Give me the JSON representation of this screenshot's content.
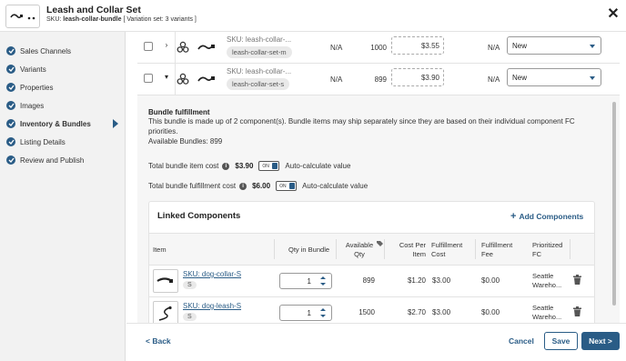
{
  "header": {
    "title": "Leash and Collar Set",
    "sku_label": "SKU:",
    "sku_value": "leash-collar-bundle",
    "variation_note": "[ Variation set: 3 variants ]",
    "close_icon": "close-icon"
  },
  "sidebar": {
    "items": [
      {
        "label": "Sales Channels",
        "icon": "check-circle-icon"
      },
      {
        "label": "Variants",
        "icon": "check-circle-icon"
      },
      {
        "label": "Properties",
        "icon": "check-circle-icon"
      },
      {
        "label": "Images",
        "icon": "check-circle-icon"
      },
      {
        "label": "Inventory & Bundles",
        "icon": "check-circle-icon",
        "active": true
      },
      {
        "label": "Listing Details",
        "icon": "check-circle-icon"
      },
      {
        "label": "Review and Publish",
        "icon": "check-circle-icon"
      }
    ]
  },
  "variants": [
    {
      "expander": "›",
      "sku": "SKU: leash-collar-...",
      "sku_pill": "leash-collar-set-m",
      "col_a": "N/A",
      "qty": "1000",
      "cost": "$3.55",
      "col_b": "N/A",
      "condition": "New"
    },
    {
      "expander": "▾",
      "sku": "SKU: leash-collar-...",
      "sku_pill": "leash-collar-set-s",
      "col_a": "N/A",
      "qty": "899",
      "cost": "$3.90",
      "col_b": "N/A",
      "condition": "New"
    }
  ],
  "bundle": {
    "title": "Bundle fulfillment",
    "description": "This bundle is made up of 2 component(s). Bundle items may ship separately since they are based on their individual component FC priorities.",
    "available": "Available Bundles: 899",
    "item_cost_label": "Total bundle item cost",
    "item_cost_value": "$3.90",
    "fulfillment_cost_label": "Total bundle fulfillment cost",
    "fulfillment_cost_value": "$6.00",
    "toggle_label": "ON",
    "auto_calc_label": "Auto-calculate value"
  },
  "linked": {
    "title": "Linked Components",
    "add_label": "Add Components",
    "columns": [
      "Item",
      "Qty in Bundle",
      "Available Qty",
      "Cost Per Item",
      "Fulfillment Cost",
      "Fulfillment Fee",
      "Prioritized FC"
    ],
    "rows": [
      {
        "sku": "SKU: dog-collar-S",
        "pill": "S",
        "qty": "1",
        "available": "899",
        "cost": "$1.20",
        "fulfillment_cost": "$3.00",
        "fee": "$0.00",
        "fc_line1": "Seattle",
        "fc_line2": "Wareho..."
      },
      {
        "sku": "SKU: dog-leash-S",
        "pill": "S",
        "qty": "1",
        "available": "1500",
        "cost": "$2.70",
        "fulfillment_cost": "$3.00",
        "fee": "$0.00",
        "fc_line1": "Seattle",
        "fc_line2": "Wareho..."
      }
    ]
  },
  "footer": {
    "back_label": "< Back",
    "cancel_label": "Cancel",
    "save_label": "Save",
    "next_label": "Next >"
  },
  "colors": {
    "accent": "#2a5c86",
    "sidebar_bg": "#f2f2f2",
    "panel_bg": "#f6f6f6"
  }
}
